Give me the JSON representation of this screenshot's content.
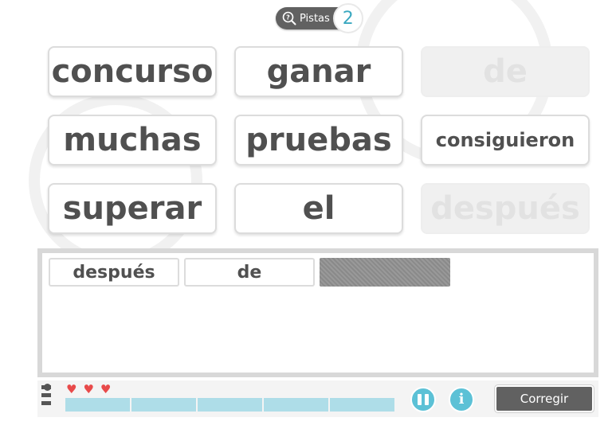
{
  "hints": {
    "label": "Pistas",
    "count": "2"
  },
  "word_tiles": [
    {
      "text": "concurso",
      "state": "available"
    },
    {
      "text": "ganar",
      "state": "available"
    },
    {
      "text": "de",
      "state": "used"
    },
    {
      "text": "muchas",
      "state": "available"
    },
    {
      "text": "pruebas",
      "state": "available"
    },
    {
      "text": "consiguieron",
      "state": "available"
    },
    {
      "text": "superar",
      "state": "available"
    },
    {
      "text": "el",
      "state": "available"
    },
    {
      "text": "después",
      "state": "used"
    }
  ],
  "answer": {
    "placed_words": [
      "después",
      "de"
    ],
    "empty_slots": 1
  },
  "status": {
    "lives": 3,
    "progress_segments_total": 5,
    "progress_segments_filled": 0
  },
  "controls": {
    "check_label": "Corregir"
  },
  "colors": {
    "accent": "#5cc1d6",
    "heart": "#e84a4a",
    "dark_button": "#616161",
    "progress": "#aedde8"
  }
}
